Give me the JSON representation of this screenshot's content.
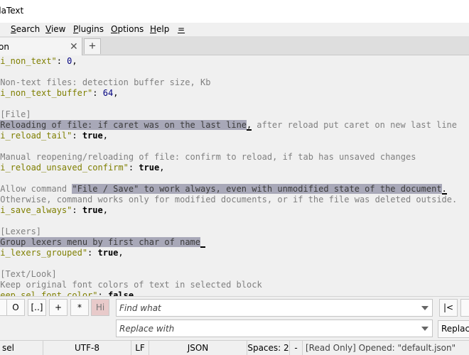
{
  "window": {
    "title": "daText"
  },
  "menu": {
    "items": [
      {
        "id": "search",
        "label": "Search"
      },
      {
        "id": "view",
        "label": "View"
      },
      {
        "id": "plugins",
        "label": "Plugins"
      },
      {
        "id": "options",
        "label": "Options"
      },
      {
        "id": "help",
        "label": "Help"
      },
      {
        "id": "more",
        "label": "="
      }
    ]
  },
  "tabs": {
    "active_label": "on",
    "close_symbol": "✕",
    "new_tab_symbol": "+"
  },
  "editor": {
    "colors": {
      "comment": "#808080",
      "key": "#7f7f00",
      "number": "#00007f",
      "selection": "#a8a8b8"
    },
    "lines": [
      [
        {
          "t": "key",
          "v": "ui_non_text\""
        },
        {
          "t": "plain",
          "v": ": "
        },
        {
          "t": "num",
          "v": "0"
        },
        {
          "t": "plain",
          "v": ","
        }
      ],
      [],
      [
        {
          "t": "cmt",
          "v": "/Non-text files: detection buffer size, Kb"
        }
      ],
      [
        {
          "t": "key",
          "v": "ui_non_text_buffer\""
        },
        {
          "t": "plain",
          "v": ": "
        },
        {
          "t": "num",
          "v": "64"
        },
        {
          "t": "plain",
          "v": ","
        }
      ],
      [],
      [
        {
          "t": "cmt",
          "v": "/[File]"
        }
      ],
      [
        {
          "t": "cmt",
          "v": "/"
        },
        {
          "t": "sel",
          "v": "Reloading of file: if caret was on the last line"
        },
        {
          "t": "caret",
          "v": ","
        },
        {
          "t": "cmt",
          "v": " after reload put caret on new last line"
        }
      ],
      [
        {
          "t": "key",
          "v": "ui_reload_tail\""
        },
        {
          "t": "plain",
          "v": ": "
        },
        {
          "t": "bool",
          "v": "true"
        },
        {
          "t": "plain",
          "v": ","
        }
      ],
      [],
      [
        {
          "t": "cmt",
          "v": "/Manual reopening/reloading of file: confirm to reload, if tab has unsaved changes"
        }
      ],
      [
        {
          "t": "key",
          "v": "ui_reload_unsaved_confirm\""
        },
        {
          "t": "plain",
          "v": ": "
        },
        {
          "t": "bool",
          "v": "true"
        },
        {
          "t": "plain",
          "v": ","
        }
      ],
      [],
      [
        {
          "t": "cmt",
          "v": "/Allow command "
        },
        {
          "t": "sel",
          "v": "\"File / Save\" to work always, even with unmodified state of the document"
        },
        {
          "t": "caret",
          "v": "."
        }
      ],
      [
        {
          "t": "cmt",
          "v": "/Otherwise, command works only for modified documents, or if the file was deleted outside."
        }
      ],
      [
        {
          "t": "key",
          "v": "ui_save_always\""
        },
        {
          "t": "plain",
          "v": ": "
        },
        {
          "t": "bool",
          "v": "true"
        },
        {
          "t": "plain",
          "v": ","
        }
      ],
      [],
      [
        {
          "t": "cmt",
          "v": "/[Lexers]"
        }
      ],
      [
        {
          "t": "cmt",
          "v": "/"
        },
        {
          "t": "sel",
          "v": "Group lexers menu by first char of name"
        },
        {
          "t": "caret",
          "v": ""
        }
      ],
      [
        {
          "t": "key",
          "v": "ui_lexers_grouped\""
        },
        {
          "t": "plain",
          "v": ": "
        },
        {
          "t": "bool",
          "v": "true"
        },
        {
          "t": "plain",
          "v": ","
        }
      ],
      [],
      [
        {
          "t": "cmt",
          "v": "/[Text/Look]"
        }
      ],
      [
        {
          "t": "cmt",
          "v": "/Keep original font colors of text in selected block"
        }
      ],
      [
        {
          "t": "key",
          "v": "keep_sel_font_color\""
        },
        {
          "t": "plain",
          "v": ": "
        },
        {
          "t": "bool",
          "v": "false"
        },
        {
          "t": "plain",
          "v": ","
        }
      ]
    ]
  },
  "findbar": {
    "buttons": [
      "O",
      "[..]",
      "+",
      "*",
      "Hi"
    ],
    "find_placeholder": "Find what",
    "replace_placeholder": "Replace with",
    "prev_label": "|<",
    "replace_label": "Replace"
  },
  "statusbar": {
    "selection": "sel",
    "encoding": "UTF-8",
    "line_ending": "LF",
    "lexer": "JSON",
    "indent": "Spaces: 2",
    "separator": "-",
    "message": "[Read Only] Opened: \"default.json\""
  }
}
